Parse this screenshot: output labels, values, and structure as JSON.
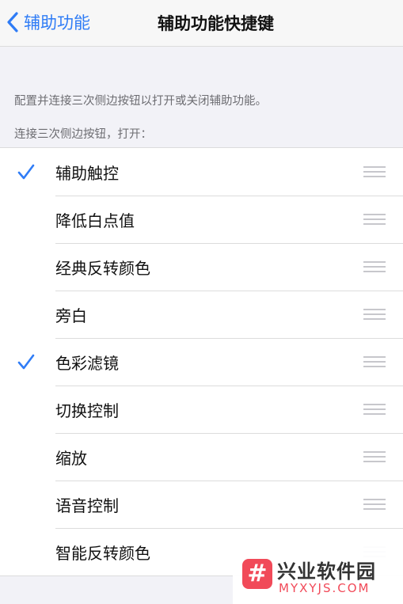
{
  "navbar": {
    "back_label": "辅助功能",
    "title": "辅助功能快捷键"
  },
  "description": "配置并连接三次侧边按钮以打开或关闭辅助功能。",
  "section_header": "连接三次侧边按钮，打开：",
  "accent_color": "#2f7cf6",
  "items": [
    {
      "label": "辅助触控",
      "checked": true
    },
    {
      "label": "降低白点值",
      "checked": false
    },
    {
      "label": "经典反转颜色",
      "checked": false
    },
    {
      "label": "旁白",
      "checked": false
    },
    {
      "label": "色彩滤镜",
      "checked": true
    },
    {
      "label": "切换控制",
      "checked": false
    },
    {
      "label": "缩放",
      "checked": false
    },
    {
      "label": "语音控制",
      "checked": false
    },
    {
      "label": "智能反转颜色",
      "checked": false
    }
  ],
  "watermark": {
    "logo_glyph": "#",
    "cn": "兴业软件园",
    "en": "MYXYJS.COM"
  }
}
